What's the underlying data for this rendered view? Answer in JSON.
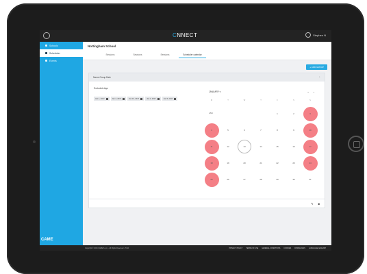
{
  "app": {
    "logo_text": "NNECT",
    "logo_ring": "C",
    "user_name": "Stephen N"
  },
  "sidebar": {
    "items": [
      {
        "label": "Schools"
      },
      {
        "label": "Scheduler"
      },
      {
        "label": "Events"
      }
    ],
    "brand": "CAME"
  },
  "page": {
    "title": "Nottingham School",
    "tabs": [
      "Sessions",
      "Sessions",
      "Sessions",
      "Scheduler calendar"
    ],
    "add_button": "+ ADD GROUP",
    "card_title": "Name Group Date",
    "excluded_label": "Excluded days",
    "chips": [
      "Jan 1, 2017",
      "Jan 2, 2017",
      "Jan 13, 2017",
      "Jan 4, 2017",
      "Jan 5, 2017"
    ]
  },
  "calendar": {
    "title": "JANUARY ▾",
    "month_label": "JAN",
    "weekdays": [
      "M",
      "T",
      "W",
      "T",
      "F",
      "S",
      "S"
    ],
    "rows": [
      [
        "",
        "",
        "",
        "",
        "1",
        "2",
        "3"
      ],
      [
        "4",
        "5",
        "6",
        "7",
        "8",
        "9",
        "10"
      ],
      [
        "11",
        "12",
        "13",
        "14",
        "15",
        "16",
        "17"
      ],
      [
        "18",
        "19",
        "20",
        "21",
        "22",
        "23",
        "24"
      ],
      [
        "25",
        "26",
        "27",
        "28",
        "29",
        "30",
        "31"
      ]
    ],
    "highlighted": [
      "3",
      "4",
      "10",
      "11",
      "17",
      "18",
      "24",
      "25"
    ],
    "today": "13",
    "highlight_color": "#f47f86"
  },
  "footer": {
    "copyright": "Copyright © 2016 CAME S.p.A. - All Rights Reserved - P.IVA",
    "links": [
      "PRIVACY POLICY",
      "TERMS OF USE",
      "GENERAL CONDITIONS",
      "COOKIES",
      "DOWNLOADS",
      "LANGUAGE: ENGLISH"
    ]
  }
}
